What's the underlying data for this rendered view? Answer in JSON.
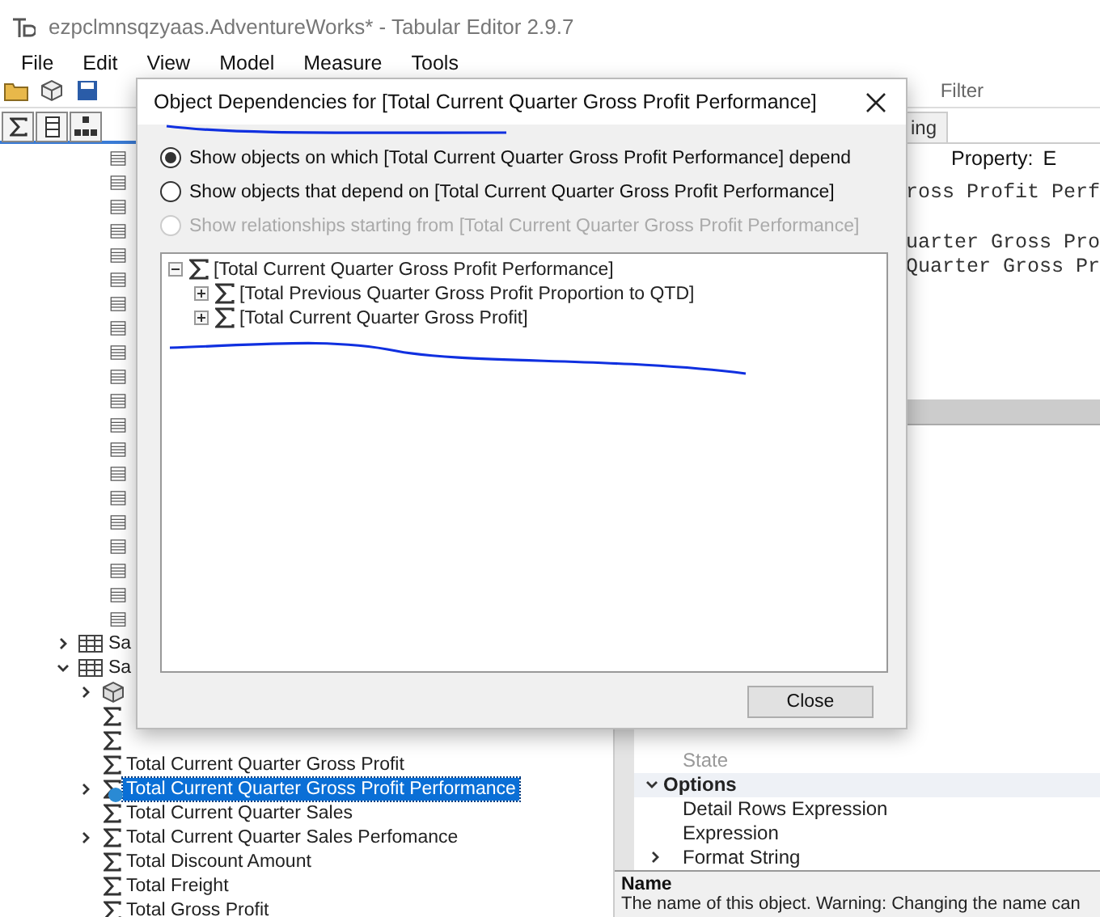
{
  "window": {
    "title": "ezpclmnsqzyaas.AdventureWorks* - Tabular Editor 2.9.7"
  },
  "menu": [
    "File",
    "Edit",
    "View",
    "Model",
    "Measure",
    "Tools"
  ],
  "toolbar": {
    "filter_label": "Filter"
  },
  "tree": {
    "items": [
      {
        "kind": "column"
      },
      {
        "kind": "column"
      },
      {
        "kind": "column"
      },
      {
        "kind": "column"
      },
      {
        "kind": "column"
      },
      {
        "kind": "column"
      },
      {
        "kind": "column"
      },
      {
        "kind": "column"
      },
      {
        "kind": "column"
      },
      {
        "kind": "column"
      },
      {
        "kind": "column"
      },
      {
        "kind": "column"
      },
      {
        "kind": "column"
      },
      {
        "kind": "column"
      },
      {
        "kind": "column"
      },
      {
        "kind": "column"
      },
      {
        "kind": "column"
      },
      {
        "kind": "column"
      },
      {
        "kind": "column"
      },
      {
        "kind": "column"
      },
      {
        "kind": "table",
        "label": "Sa",
        "expanded": false,
        "selected": false
      },
      {
        "kind": "table",
        "label": "Sa",
        "expanded": true,
        "selected": false,
        "children": [
          {
            "kind": "folder",
            "expanded": false
          },
          {
            "kind": "measure"
          },
          {
            "kind": "measure"
          },
          {
            "kind": "measure",
            "label": "Total Current Quarter Gross Profit",
            "selected": false
          },
          {
            "kind": "measure",
            "label": "Total Current Quarter Gross Profit Performance",
            "selected": true,
            "expanded": false,
            "warning": true
          },
          {
            "kind": "measure",
            "label": "Total Current Quarter Sales",
            "selected": false
          },
          {
            "kind": "measure",
            "label": "Total Current Quarter Sales Perfomance",
            "selected": false,
            "expanded": false
          },
          {
            "kind": "measure",
            "label": "Total Discount Amount",
            "selected": false
          },
          {
            "kind": "measure",
            "label": "Total Freight",
            "selected": false
          },
          {
            "kind": "measure",
            "label": "Total Gross Profit",
            "selected": false
          }
        ]
      }
    ]
  },
  "editor": {
    "tab": "ing",
    "property_label": "Property:",
    "property_value": "E",
    "code_lines": [
      "ross Profit Perf",
      "uarter Gross Pro",
      "Quarter Gross Pr"
    ]
  },
  "properties": {
    "rows": [
      {
        "kind": "property",
        "label": "State",
        "disabled": true
      },
      {
        "kind": "category",
        "label": "Options",
        "expanded": true
      },
      {
        "kind": "property",
        "label": "Detail Rows Expression",
        "disabled": false
      },
      {
        "kind": "property",
        "label": "Expression",
        "disabled": false
      },
      {
        "kind": "property",
        "label": "Format String",
        "disabled": false,
        "expanded": false
      }
    ],
    "description": {
      "title": "Name",
      "text": "The name of this object. Warning: Changing the name can"
    }
  },
  "dialog": {
    "title": "Object Dependencies for [Total Current Quarter Gross Profit Performance]",
    "options": [
      {
        "label": "Show objects on which [Total Current Quarter Gross Profit Performance] depend",
        "selected": true,
        "disabled": false
      },
      {
        "label": "Show objects that depend on [Total Current Quarter Gross Profit Performance]",
        "selected": false,
        "disabled": false
      },
      {
        "label": "Show relationships starting from [Total Current Quarter Gross Profit Performance]",
        "selected": false,
        "disabled": true
      }
    ],
    "tree": [
      {
        "label": "[Total Current Quarter Gross Profit Performance]",
        "expanded": true,
        "children": [
          {
            "label": "[Total Previous Quarter Gross Profit Proportion to QTD]",
            "expanded": false
          },
          {
            "label": "[Total Current Quarter Gross Profit]",
            "expanded": false
          }
        ]
      }
    ],
    "close_button": "Close"
  }
}
